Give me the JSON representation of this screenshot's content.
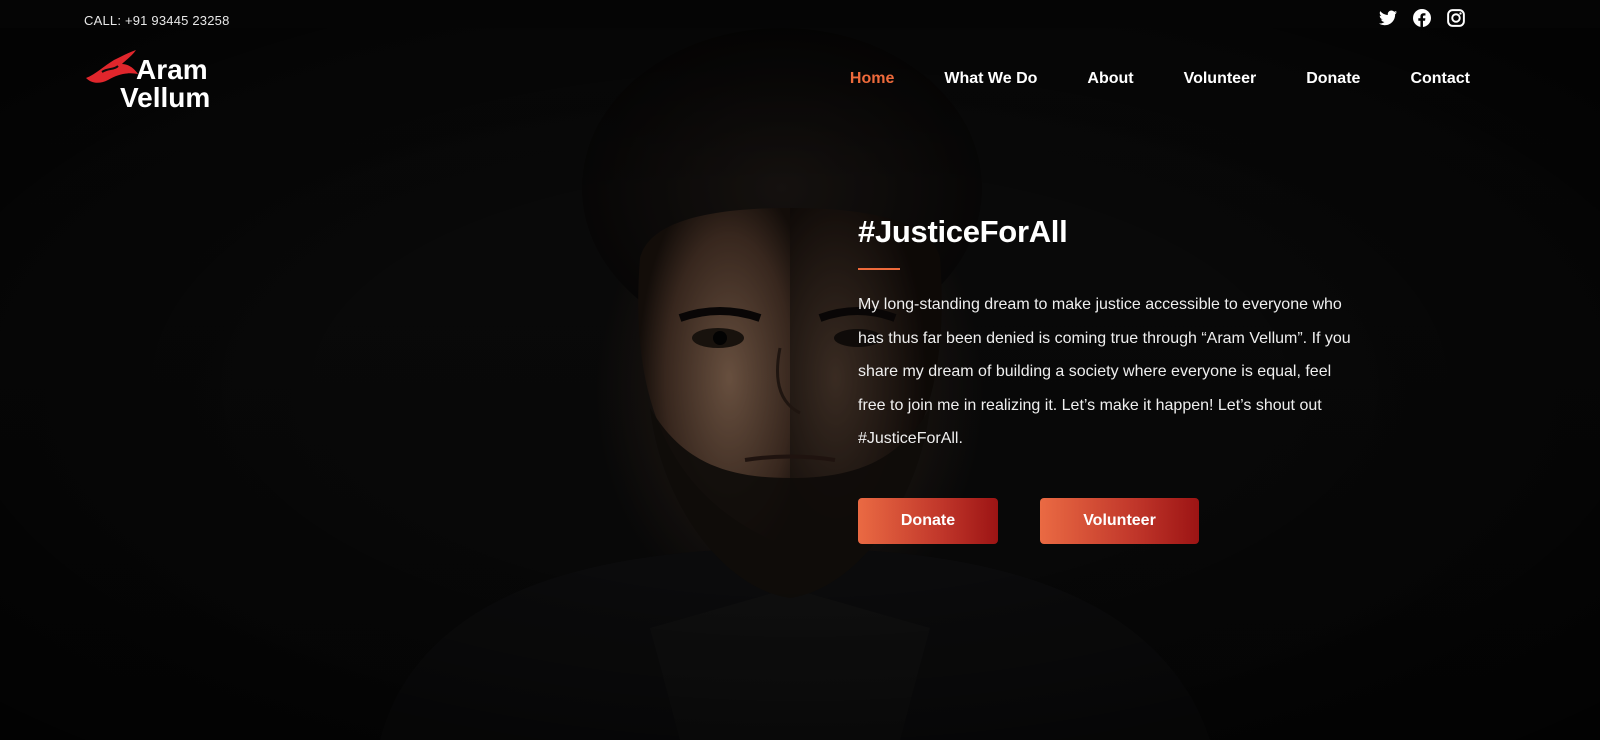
{
  "topbar": {
    "call_text": "CALL: +91 93445 23258",
    "social_icons": [
      "twitter-icon",
      "facebook-icon",
      "instagram-icon"
    ]
  },
  "logo": {
    "line1": "Aram",
    "line2": "Vellum",
    "accent_color": "#e0262c"
  },
  "nav": {
    "items": [
      {
        "label": "Home",
        "active": true
      },
      {
        "label": "What We Do",
        "active": false
      },
      {
        "label": "About",
        "active": false
      },
      {
        "label": "Volunteer",
        "active": false
      },
      {
        "label": "Donate",
        "active": false
      },
      {
        "label": "Contact",
        "active": false
      }
    ],
    "active_color": "#ee6a3b"
  },
  "hero": {
    "heading": "#JusticeForAll",
    "body": "My long-standing dream to make justice accessible to everyone who has thus far been denied is coming true through “Aram Vellum”. If you share my dream of building a society where everyone is equal, feel free to join me in realizing it. Let’s make it happen! Let’s shout out #JusticeForAll.",
    "buttons": {
      "donate": "Donate",
      "volunteer": "Volunteer"
    }
  },
  "colors": {
    "accent": "#ee6a3b",
    "button_gradient_start": "#ea6a43",
    "button_gradient_end": "#9c1414",
    "background": "#0c0c0c"
  }
}
